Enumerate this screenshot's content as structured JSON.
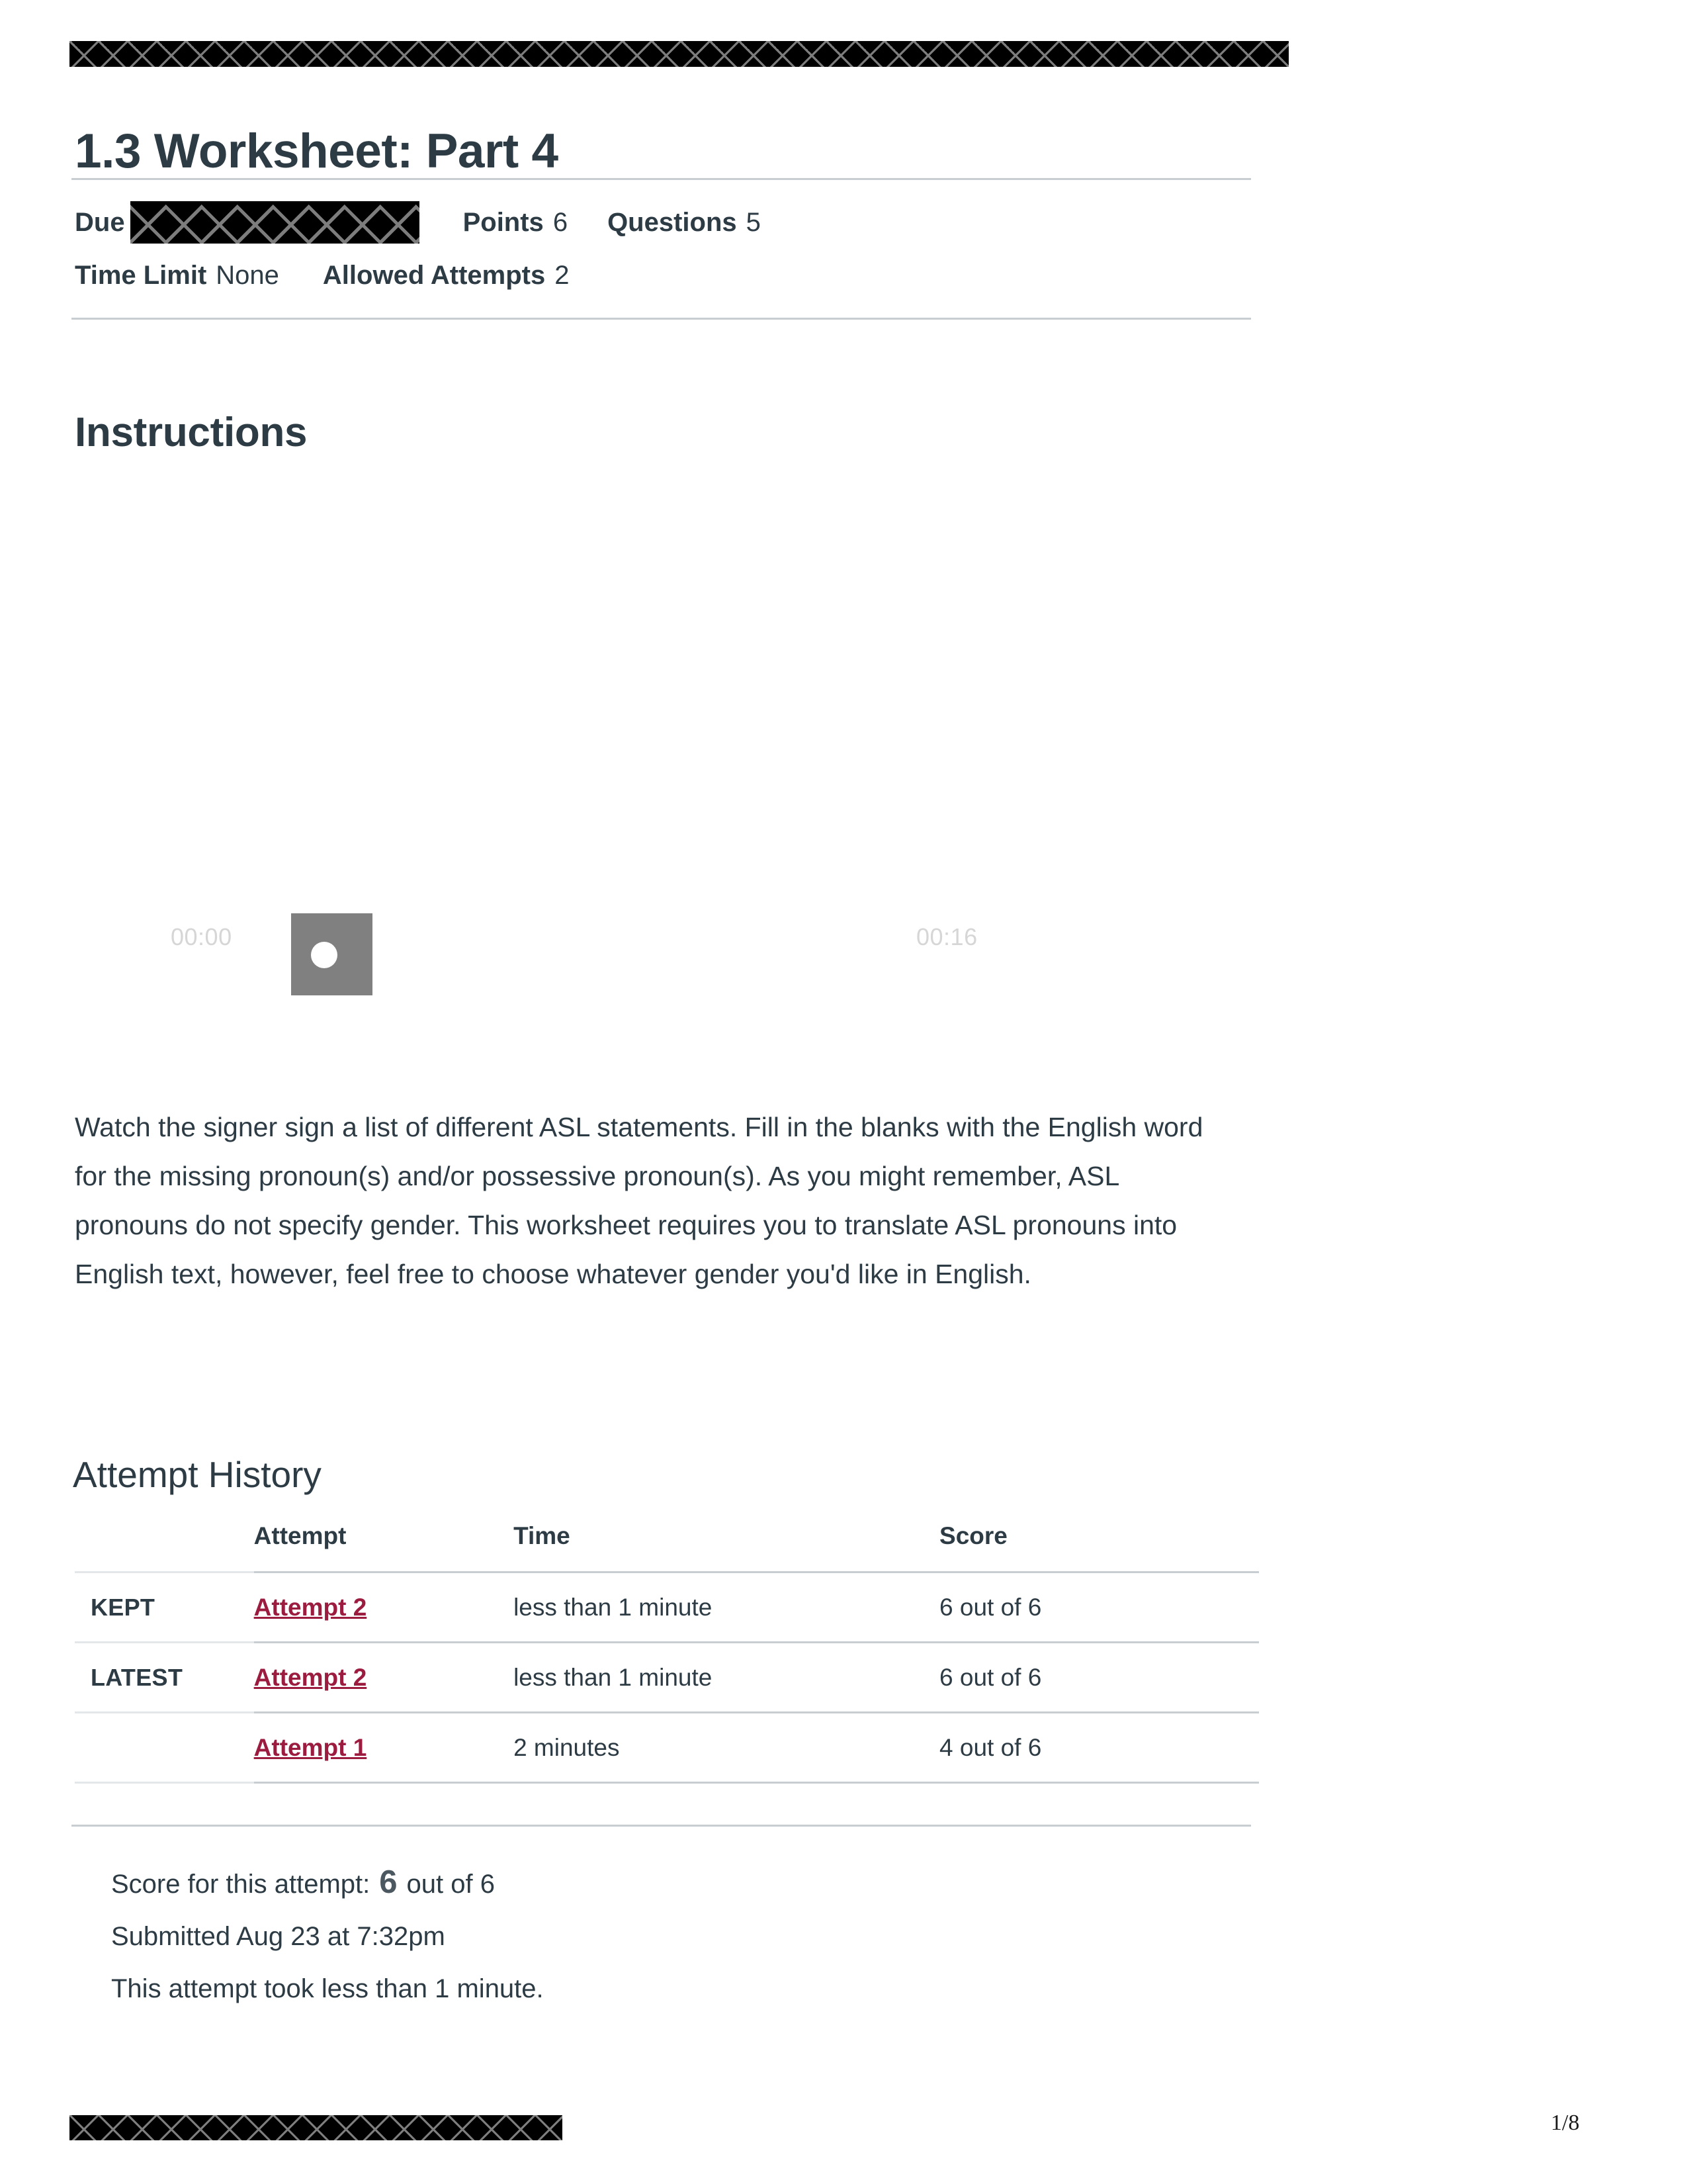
{
  "document": {
    "title": "1.3 Worksheet: Part 4",
    "page_number": "1/8"
  },
  "quiz_meta": {
    "due_label": "Due",
    "due_value_redacted": true,
    "points_label": "Points",
    "points_value": "6",
    "questions_label": "Questions",
    "questions_value": "5",
    "time_limit_label": "Time Limit",
    "time_limit_value": "None",
    "allowed_attempts_label": "Allowed Attempts",
    "allowed_attempts_value": "2"
  },
  "instructions": {
    "heading": "Instructions",
    "body": "Watch the signer sign a list of different ASL statements. Fill in the blanks with the English word for the missing pronoun(s) and/or possessive pronoun(s).  As you might remember, ASL pronouns do not specify gender.  This worksheet requires you to translate ASL pronouns into English text, however, feel free to choose whatever gender you'd like in English."
  },
  "video": {
    "current_time": "00:00",
    "duration": "00:16"
  },
  "attempt_history": {
    "heading": "Attempt History",
    "columns": [
      "",
      "Attempt",
      "Time",
      "Score"
    ],
    "rows": [
      {
        "label": "KEPT",
        "attempt": "Attempt 2 ",
        "time": "less than 1 minute",
        "score": "6 out of 6"
      },
      {
        "label": "LATEST",
        "attempt": "Attempt 2 ",
        "time": "less than 1 minute",
        "score": "6 out of 6"
      },
      {
        "label": "",
        "attempt": "Attempt 1 ",
        "time": "2 minutes",
        "score": "4 out of 6"
      }
    ]
  },
  "score_summary": {
    "score_prefix": "Score for this attempt:",
    "score_value": "6",
    "score_suffix": "out of 6",
    "submitted": "Submitted Aug 23 at 7:32pm",
    "duration": "This attempt took less than 1 minute."
  },
  "colors": {
    "link": "#9c1c40",
    "text": "#2d3b45",
    "rule": "#c7cdd1"
  }
}
